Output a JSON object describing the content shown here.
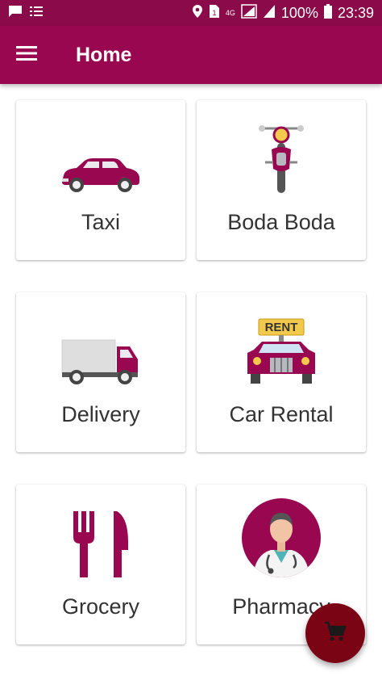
{
  "status_bar": {
    "battery": "100%",
    "time": "23:39",
    "network": "4G",
    "icons": [
      "message-icon",
      "list-icon",
      "location-icon",
      "sim-icon",
      "signal-icon",
      "battery-icon"
    ]
  },
  "app_bar": {
    "title": "Home",
    "menu_icon": "hamburger-menu-icon",
    "background": "#98074f"
  },
  "services": [
    {
      "label": "Taxi",
      "icon": "car-icon"
    },
    {
      "label": "Boda Boda",
      "icon": "motorcycle-icon"
    },
    {
      "label": "Delivery",
      "icon": "truck-icon"
    },
    {
      "label": "Car Rental",
      "icon": "rent-car-icon",
      "sign_text": "RENT"
    },
    {
      "label": "Grocery",
      "icon": "fork-knife-icon"
    },
    {
      "label": "Pharmacy",
      "icon": "doctor-icon"
    }
  ],
  "fab": {
    "icon": "cart-icon",
    "color": "#7a0414"
  }
}
